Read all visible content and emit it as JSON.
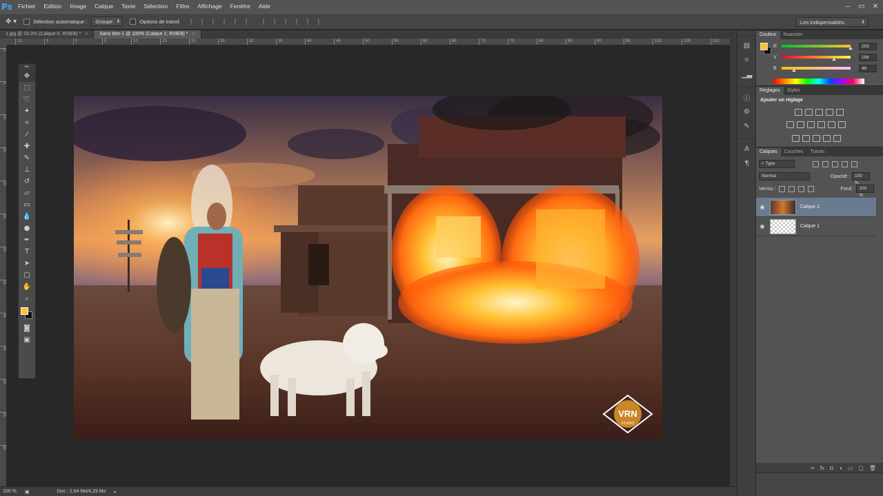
{
  "app": {
    "logo": "Ps"
  },
  "menu": [
    "Fichier",
    "Edition",
    "Image",
    "Calque",
    "Texte",
    "Sélection",
    "Filtre",
    "Affichage",
    "Fenêtre",
    "Aide"
  ],
  "window_controls": [
    "–",
    "▭",
    "✕"
  ],
  "options": {
    "auto_select_label": "Sélection automatique :",
    "auto_select_value": "Groupe",
    "transform_label": "Options de transf.",
    "workspace": "Les indispensables"
  },
  "tabs": [
    {
      "label": "1.jpg @ 33,3% (Calque 0, RVB/8) *",
      "close": "×"
    },
    {
      "label": "Sans titre-1 @ 100% (Calque 2, RVB/8) *",
      "close": "×"
    }
  ],
  "ruler_h": [
    "10",
    "5",
    "0",
    "5",
    "10",
    "15",
    "20",
    "25",
    "30",
    "35",
    "40",
    "45",
    "50",
    "55",
    "60",
    "65",
    "70",
    "75",
    "80",
    "85",
    "90",
    "95",
    "100",
    "105",
    "110",
    "115"
  ],
  "ruler_v": [
    "0",
    "5",
    "10",
    "15",
    "20",
    "25",
    "30",
    "35",
    "40",
    "45",
    "50",
    "55",
    "60"
  ],
  "colors": {
    "foreground": "#ffc22e",
    "background": "#111111",
    "accent_selected": "#6a7a8f"
  },
  "tools": [
    "move-icon",
    "marquee-icon",
    "lasso-icon",
    "magic-wand-icon",
    "crop-icon",
    "eyedropper-icon",
    "healing-icon",
    "brush-icon",
    "stamp-icon",
    "history-brush-icon",
    "eraser-icon",
    "gradient-icon",
    "blur-icon",
    "dodge-icon",
    "pen-icon",
    "type-icon",
    "path-select-icon",
    "shape-icon",
    "hand-icon",
    "zoom-icon"
  ],
  "color_panel": {
    "tabs": [
      "Couleur",
      "Nuancier"
    ],
    "channels": [
      {
        "label": "R",
        "value": "255",
        "level": 1.0
      },
      {
        "label": "V",
        "value": "194",
        "level": 0.76
      },
      {
        "label": "B",
        "value": "46",
        "level": 0.18
      }
    ]
  },
  "adjust_panel": {
    "tabs": [
      "Réglages",
      "Styles"
    ],
    "title": "Ajouter un réglage"
  },
  "layers_panel": {
    "tabs": [
      "Calques",
      "Couches",
      "Tracés"
    ],
    "filter": "Type",
    "blend_mode": "Normal",
    "opacity_label": "Opacité :",
    "opacity_value": "100 %",
    "lock_label": "Verrou :",
    "fill_label": "Fond :",
    "fill_value": "100 %",
    "layers": [
      {
        "name": "Calque 2",
        "selected": true
      },
      {
        "name": "Calque 1",
        "selected": false
      }
    ]
  },
  "status": {
    "zoom": "100 %",
    "doc": "Doc : 2,64 Mo/4,29 Mo",
    "arrow": "▸"
  },
  "artwork": {
    "logo_text": "VRN",
    "logo_sub": "STUDIO"
  }
}
